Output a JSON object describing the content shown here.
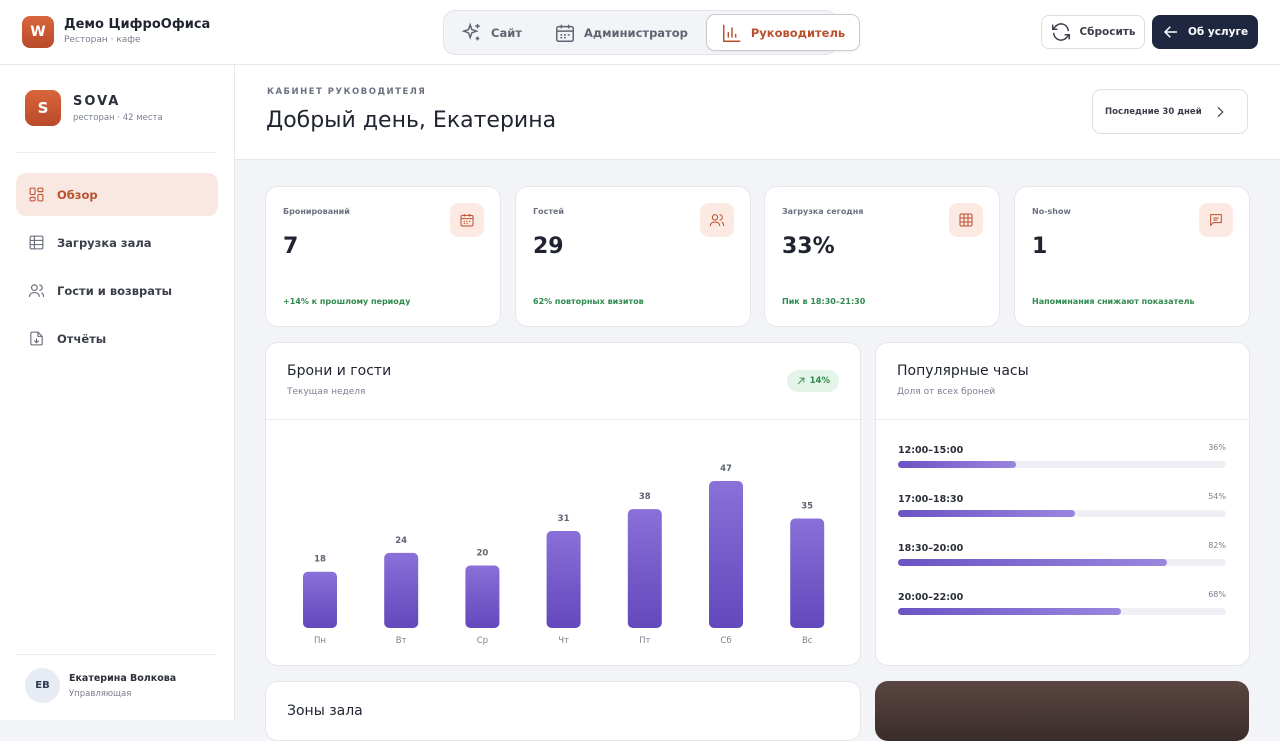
{
  "app": {
    "title": "Демо ЦифроОфиса",
    "subtitle": "Ресторан · кафе",
    "logo_letter": "W"
  },
  "modes": [
    {
      "label": "Сайт",
      "icon": "sparkles-icon",
      "active": false
    },
    {
      "label": "Администратор",
      "icon": "calendar-icon",
      "active": false
    },
    {
      "label": "Руководитель",
      "icon": "bar-chart-icon",
      "active": true
    }
  ],
  "actions": {
    "reset_label": "Сбросить",
    "about_label": "Об услуге"
  },
  "venue": {
    "letter": "S",
    "name": "SOVA",
    "subtitle": "ресторан · 42 места"
  },
  "nav": [
    {
      "label": "Обзор",
      "icon": "grid-icon",
      "active": true
    },
    {
      "label": "Загрузка зала",
      "icon": "table-icon",
      "active": false
    },
    {
      "label": "Гости и возвраты",
      "icon": "users-icon",
      "active": false
    },
    {
      "label": "Отчёты",
      "icon": "file-download-icon",
      "active": false
    }
  ],
  "user": {
    "initials": "ЕВ",
    "name": "Екатерина Волкова",
    "role": "Управляющая"
  },
  "header": {
    "eyebrow": "КАБИНЕТ РУКОВОДИТЕЛЯ",
    "greeting": "Добрый день, Екатерина",
    "period_label": "Последние 30 дней"
  },
  "kpis": [
    {
      "label": "Бронирований",
      "value": "7",
      "note": "+14% к прошлому периоду",
      "icon": "calendar-icon"
    },
    {
      "label": "Гостей",
      "value": "29",
      "note": "62% повторных визитов",
      "icon": "users-icon"
    },
    {
      "label": "Загрузка сегодня",
      "value": "33%",
      "note": "Пик в 18:30–21:30",
      "icon": "table-icon"
    },
    {
      "label": "No-show",
      "value": "1",
      "note": "Напоминания снижают показатель",
      "icon": "message-icon"
    }
  ],
  "bookings_panel": {
    "title": "Брони и гости",
    "subtitle": "Текущая неделя",
    "trend_label": "14%"
  },
  "chart_data": {
    "type": "bar",
    "categories": [
      "Пн",
      "Вт",
      "Ср",
      "Чт",
      "Пт",
      "Сб",
      "Вс"
    ],
    "values": [
      18,
      24,
      20,
      31,
      38,
      47,
      35
    ],
    "ylim": [
      0,
      47
    ],
    "color": "#6f57c8",
    "grid": false
  },
  "hours_panel": {
    "title": "Популярные часы",
    "subtitle": "Доля от всех броней",
    "rows": [
      {
        "label": "12:00–15:00",
        "pct_label": "36%",
        "value": 0.36
      },
      {
        "label": "17:00–18:30",
        "pct_label": "54%",
        "value": 0.54
      },
      {
        "label": "18:30–20:00",
        "pct_label": "82%",
        "value": 0.82
      },
      {
        "label": "20:00–22:00",
        "pct_label": "68%",
        "value": 0.68
      }
    ]
  },
  "zones_panel": {
    "title": "Зоны зала"
  }
}
